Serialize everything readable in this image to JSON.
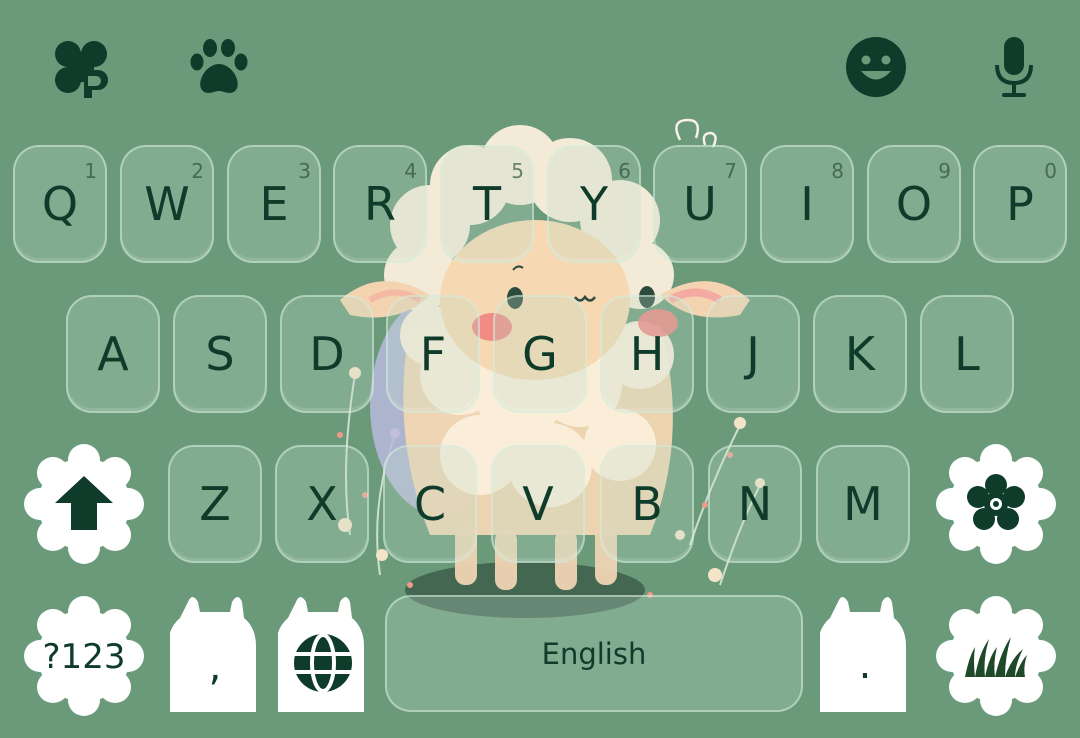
{
  "toolbar": {
    "left_icons": [
      "clover-icon",
      "paw-icon"
    ],
    "right_icons": [
      "emoji-icon",
      "microphone-icon"
    ]
  },
  "rows": {
    "row1": [
      {
        "key": "Q",
        "hint": "1"
      },
      {
        "key": "W",
        "hint": "2"
      },
      {
        "key": "E",
        "hint": "3"
      },
      {
        "key": "R",
        "hint": "4"
      },
      {
        "key": "T",
        "hint": "5"
      },
      {
        "key": "Y",
        "hint": "6"
      },
      {
        "key": "U",
        "hint": "7"
      },
      {
        "key": "I",
        "hint": "8"
      },
      {
        "key": "O",
        "hint": "9"
      },
      {
        "key": "P",
        "hint": "0"
      }
    ],
    "row2": [
      "A",
      "S",
      "D",
      "F",
      "G",
      "H",
      "J",
      "K",
      "L"
    ],
    "row3": [
      "Z",
      "X",
      "C",
      "V",
      "B",
      "N",
      "M"
    ]
  },
  "bottom": {
    "symbols_label": "?123",
    "comma_label": ",",
    "space_label": "English",
    "period_label": "."
  },
  "colors": {
    "background": "#6b9a7b",
    "key_text": "#0f3b2b",
    "accent_white": "#ffffff"
  }
}
